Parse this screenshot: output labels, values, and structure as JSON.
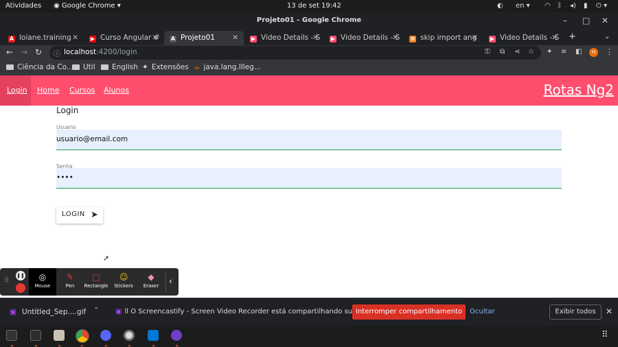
{
  "system_bar": {
    "activities": "Atividades",
    "app_name": "Google Chrome",
    "clock": "13 de set  19:42",
    "lang": "en"
  },
  "window": {
    "title": "Projeto01 - Google Chrome"
  },
  "tabs": [
    {
      "label": "loiane.training",
      "fav_color": "#dd1b16",
      "fav": "A"
    },
    {
      "label": "Curso Angular #",
      "fav_color": "#ff0000",
      "fav": "▶"
    },
    {
      "label": "Projeto01",
      "fav_color": "#444",
      "fav": "A",
      "active": true
    },
    {
      "label": "Video Details - S",
      "fav_color": "#ff4d6d",
      "fav": "▶"
    },
    {
      "label": "Video Details - S",
      "fav_color": "#ff4d6d",
      "fav": "▶"
    },
    {
      "label": "skip import ang",
      "fav_color": "#f48024",
      "fav": "≡"
    },
    {
      "label": "Video Details - S",
      "fav_color": "#ff4d6d",
      "fav": "▶"
    }
  ],
  "address": {
    "host": "localhost",
    "path": ":4200/login"
  },
  "bookmarks": [
    {
      "label": "Ciência da Co..."
    },
    {
      "label": "Util"
    },
    {
      "label": "English"
    },
    {
      "label": "Extensões"
    },
    {
      "label": "java.lang.Illeg..."
    }
  ],
  "app": {
    "nav": [
      "Login",
      "Home",
      "Cursos",
      "Alunos"
    ],
    "brand": "Rotas Ng2",
    "login_title": "Login",
    "user_label": "Usuario",
    "user_value": "usuario@email.com",
    "pass_label": "Senha",
    "pass_value": "••••",
    "login_button": "LOGIN",
    "accent": "#ff4d6d"
  },
  "screencastify": {
    "tools": [
      "Mouse",
      "Pen",
      "Rectangle",
      "Stickers",
      "Eraser"
    ]
  },
  "download_bar": {
    "file": "Untitled_Sep....gif",
    "share_text": "ll  O Screencastify - Screen Video Recorder está compartilhando sua tela.",
    "stop_button": "Interromper compartilhamento",
    "hide_link": "Ocultar",
    "show_all": "Exibir todos"
  }
}
